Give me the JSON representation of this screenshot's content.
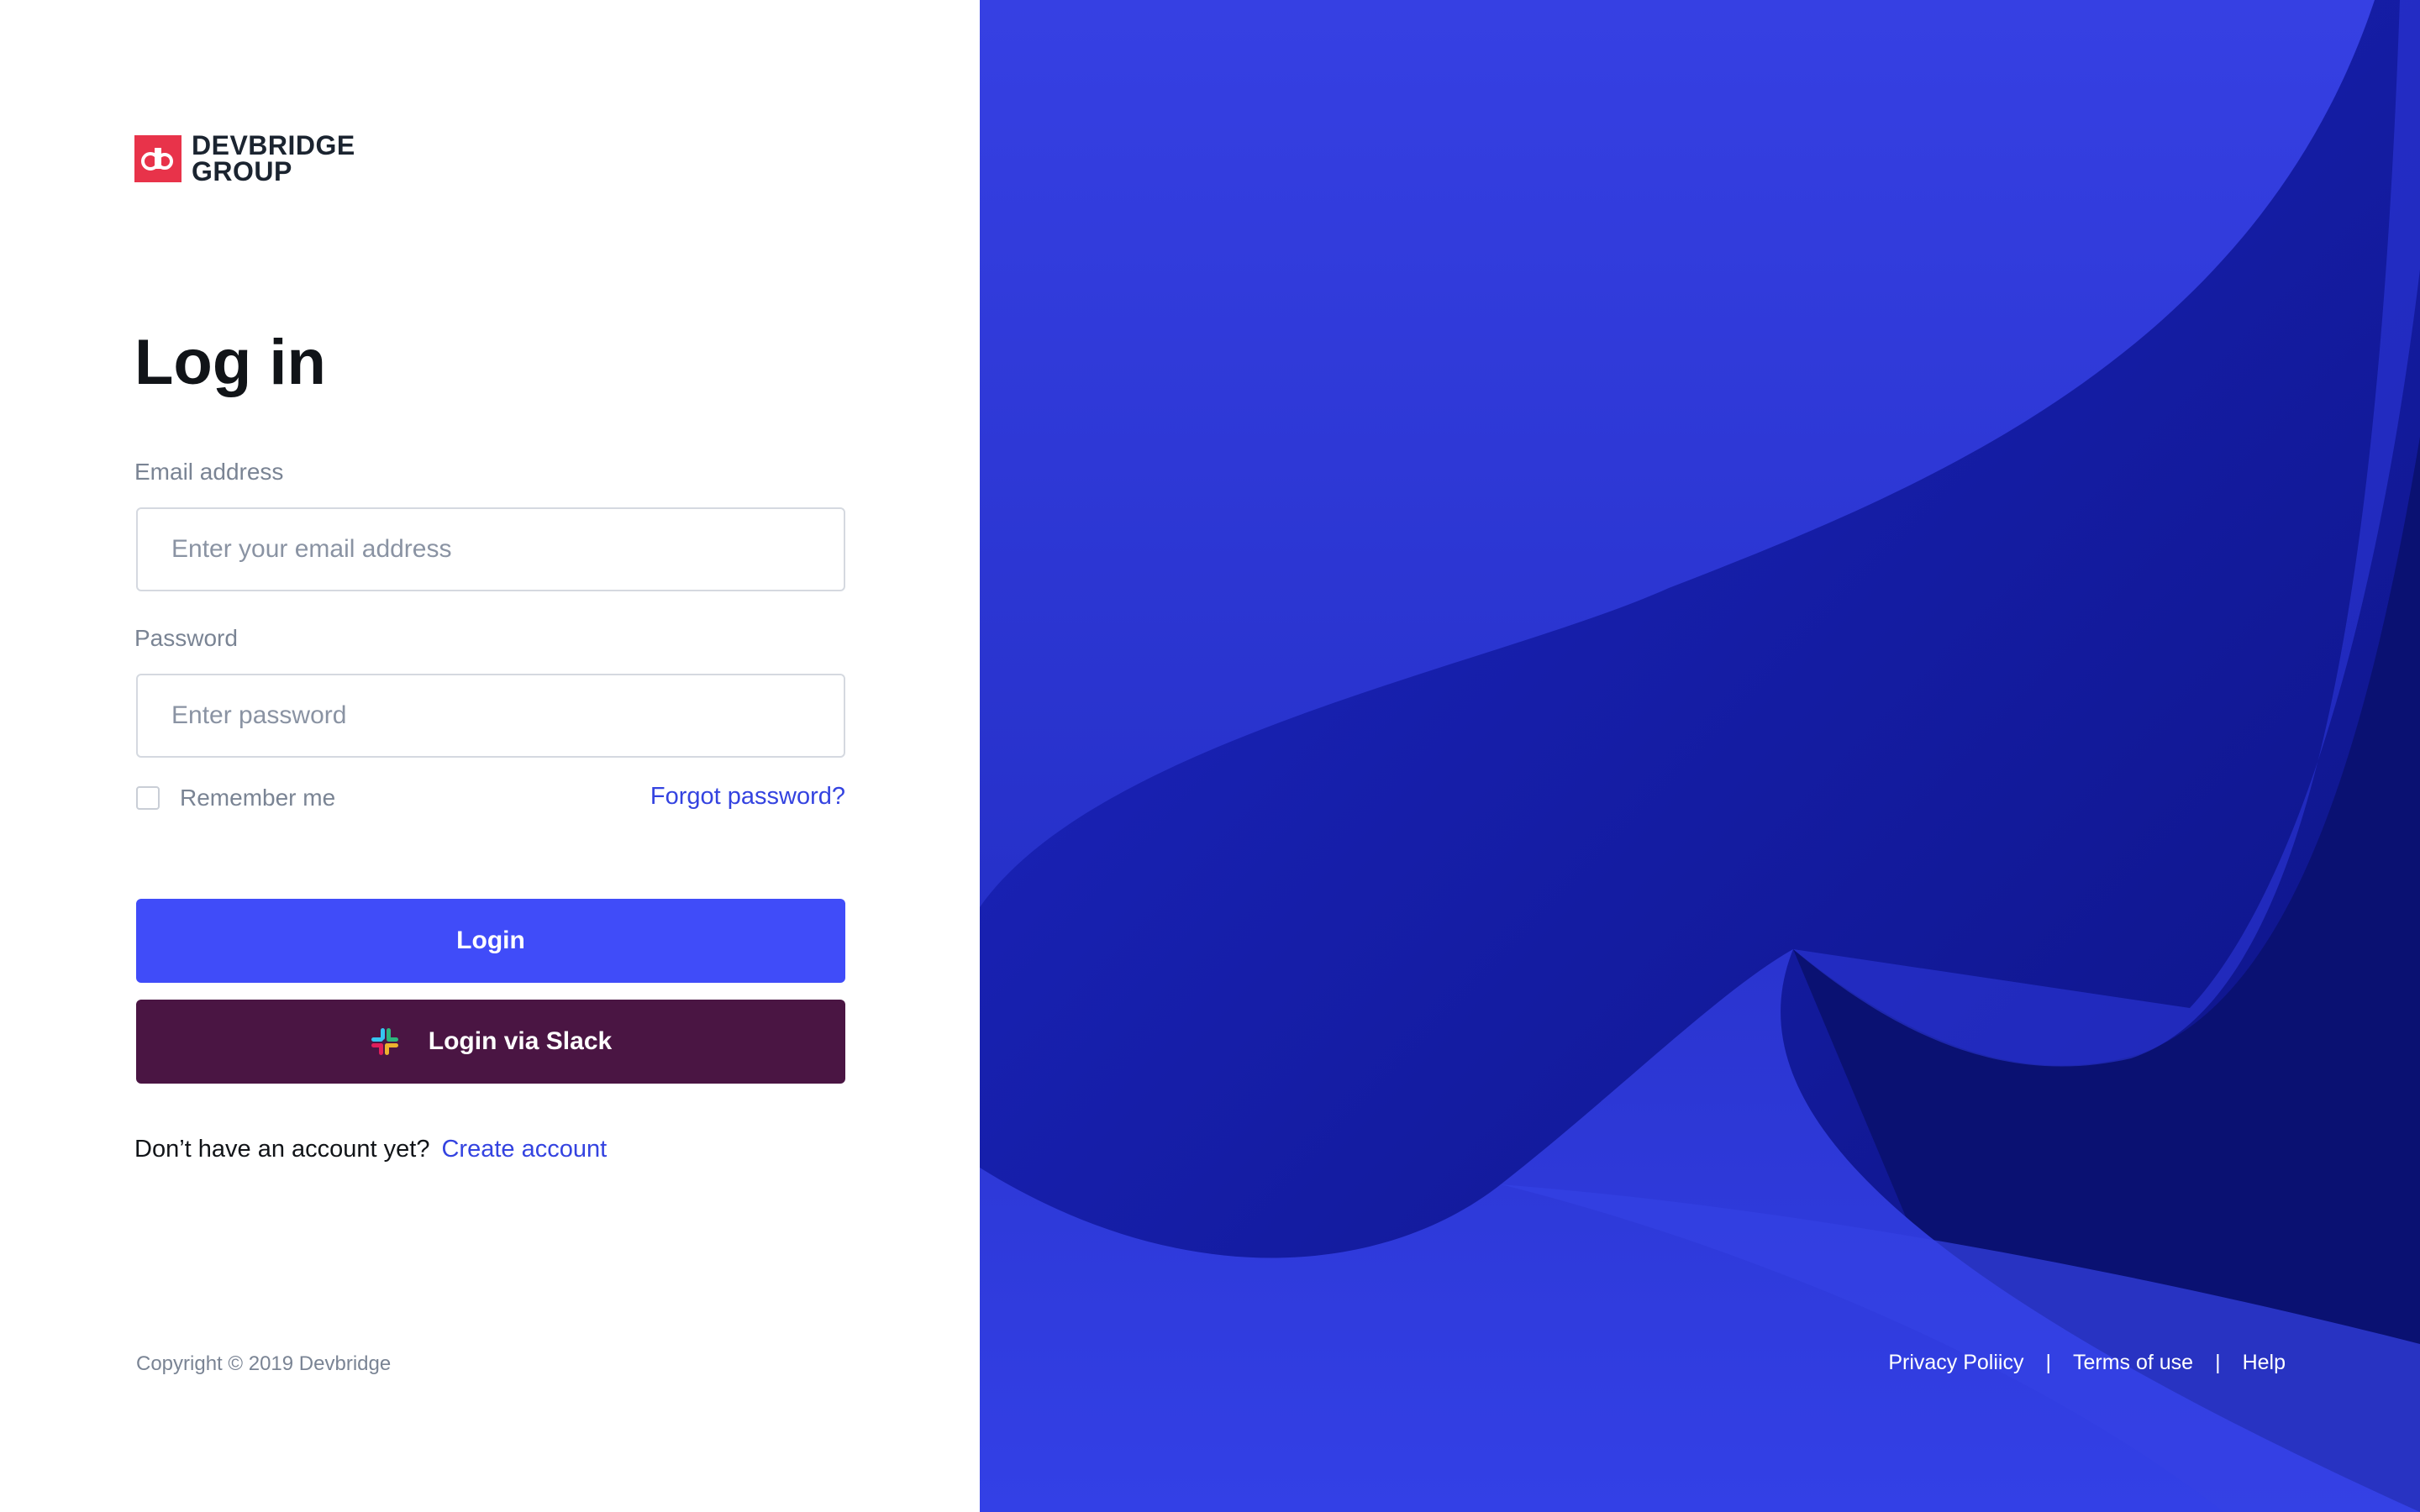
{
  "brand": {
    "line1": "DEVBRIDGE",
    "line2": "GROUP",
    "mark_color": "#e8334a"
  },
  "login": {
    "title": "Log in",
    "email_label": "Email address",
    "email_placeholder": "Enter your email address",
    "email_value": "",
    "password_label": "Password",
    "password_placeholder": "Enter password",
    "password_value": "",
    "remember_label": "Remember me",
    "remember_checked": false,
    "forgot_label": "Forgot password?",
    "login_button": "Login",
    "slack_button": "Login via Slack",
    "signup_prompt": "Don’t have an account yet?",
    "signup_link": "Create account"
  },
  "footer": {
    "copyright": "Copyright © 2019 Devbridge",
    "links": [
      "Privacy Poliicy",
      "Terms of use",
      "Help"
    ],
    "separator": "|"
  },
  "colors": {
    "accent": "#404cf9",
    "link": "#3443e0",
    "slack": "#4a1543",
    "hero_blue": "#1f2bd6"
  }
}
